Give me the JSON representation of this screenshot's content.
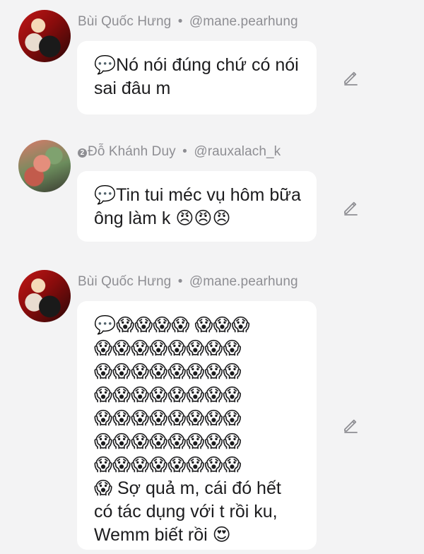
{
  "messages": [
    {
      "author": "Bùi Quốc Hưng",
      "handle": "@mane.pearhung",
      "separator": "•",
      "text": "💬Nó nói đúng chứ có nói sai đâu m",
      "avatar_icon": "anime-avatar-red"
    },
    {
      "badge": "2",
      "author": "Đỗ Khánh Duy",
      "handle": "@rauxalach_k",
      "separator": "•",
      "text": "💬Tin tui méc vụ hôm bữa ông làm k 😠😠😠",
      "avatar_icon": "anime-avatar-pink"
    },
    {
      "author": "Bùi Quốc Hưng",
      "handle": "@mane.pearhung",
      "separator": "•",
      "text": "💬😱😱😱😱 😱😱😱\n😱😱😱😱😱😱😱😱\n😱😱😱😱😱😱😱😱\n😱😱😱😱😱😱😱😱\n😱😱😱😱😱😱😱😱\n😱😱😱😱😱😱😱😱\n😱😱😱😱😱😱😱😱\n😱 Sợ quả m, cái đó hết có tác dụng với t rồi ku, Wemm biết rồi 😍",
      "avatar_icon": "anime-avatar-red"
    }
  ],
  "icons": {
    "edit": "pencil-icon"
  },
  "colors": {
    "background": "#f3f3f4",
    "bubble": "#ffffff",
    "meta_text": "#8e8e93",
    "body_text": "#1c1c1e"
  }
}
